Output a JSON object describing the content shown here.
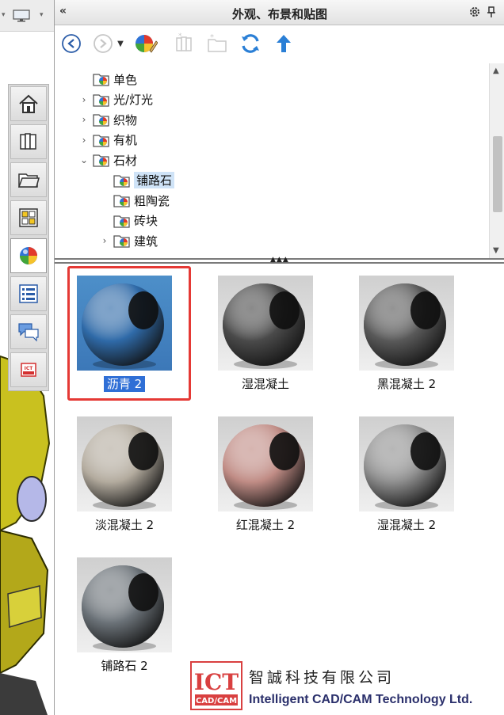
{
  "panel": {
    "title": "外观、布景和贴图",
    "collapse_glyph": "«"
  },
  "tree": {
    "items": [
      {
        "label": "单色",
        "expand": ""
      },
      {
        "label": "光/灯光",
        "expand": "›"
      },
      {
        "label": "织物",
        "expand": "›"
      },
      {
        "label": "有机",
        "expand": "›"
      },
      {
        "label": "石材",
        "expand": "⌄"
      },
      {
        "label": "铺路石",
        "expand": ""
      },
      {
        "label": "粗陶瓷",
        "expand": ""
      },
      {
        "label": "砖块",
        "expand": ""
      },
      {
        "label": "建筑",
        "expand": "›"
      }
    ],
    "selected_index": 5
  },
  "materials": [
    {
      "label": "沥青 2",
      "selected": true,
      "color": "#2f6aa8",
      "bg": "#4d8fc9"
    },
    {
      "label": "湿混凝土",
      "selected": false,
      "color": "#4a4a4a",
      "bg": "#d4d4d4"
    },
    {
      "label": "黑混凝土 2",
      "selected": false,
      "color": "#595959",
      "bg": "#d4d4d4"
    },
    {
      "label": "淡混凝土 2",
      "selected": false,
      "color": "#b3ab9e",
      "bg": "#d4d4d4"
    },
    {
      "label": "红混凝土 2",
      "selected": false,
      "color": "#c08c85",
      "bg": "#d4d4d4"
    },
    {
      "label": "湿混凝土 2",
      "selected": false,
      "color": "#8f8f8f",
      "bg": "#d4d4d4"
    },
    {
      "label": "铺路石 2",
      "selected": false,
      "color": "#6b7278",
      "bg": "#d4d4d4"
    }
  ],
  "watermark": {
    "logo_text": "ICT",
    "logo_sub": "CAD/CAM",
    "company_cn": "智誠科技有限公司",
    "company_en": "Intelligent CAD/CAM Technology Ltd."
  },
  "colors": {
    "highlight": "#e53935",
    "selection": "#2f6fd6"
  }
}
